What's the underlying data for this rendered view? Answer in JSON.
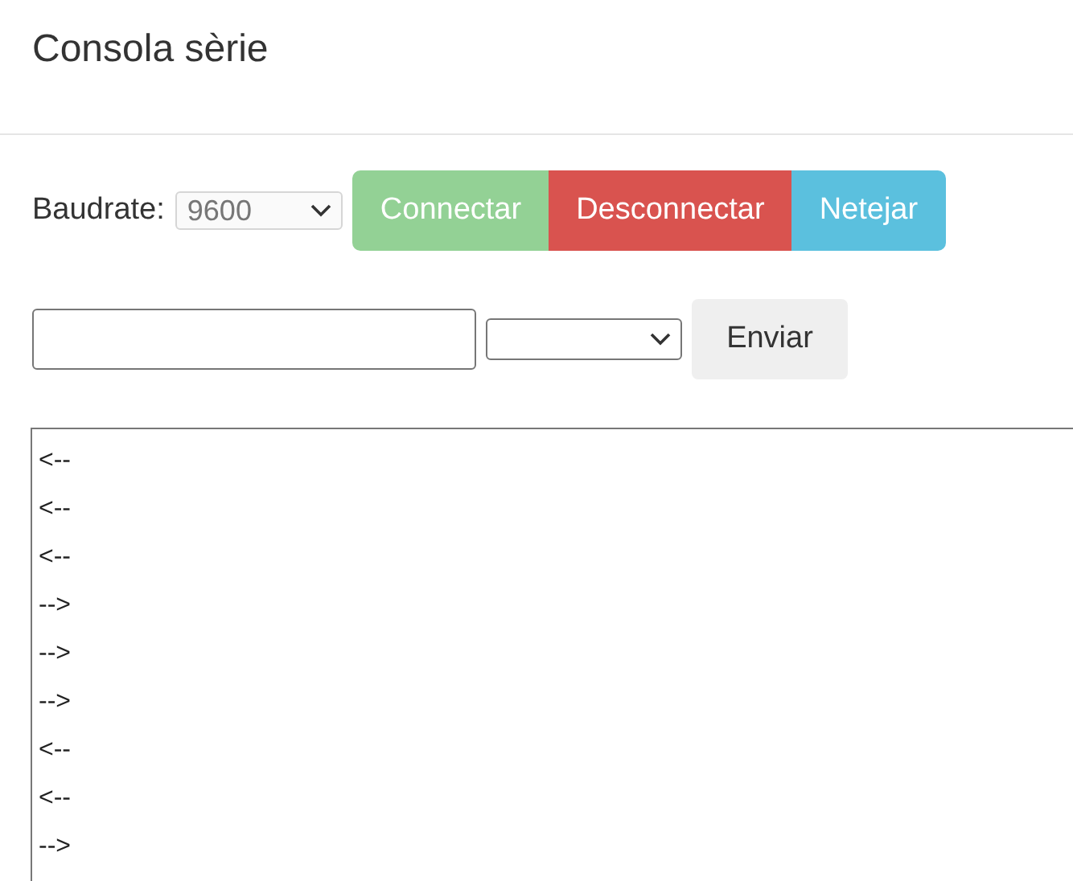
{
  "header": {
    "title": "Consola sèrie"
  },
  "controls": {
    "baud_label": "Baudrate:",
    "baud_value": "9600",
    "buttons": [
      {
        "label": "Connectar",
        "kind": "success"
      },
      {
        "label": "Desconnectar",
        "kind": "danger"
      },
      {
        "label": "Netejar",
        "kind": "info"
      }
    ]
  },
  "send": {
    "send_button": "Enviar"
  },
  "console": {
    "lines": [
      "<--",
      "<--",
      "<--",
      "-->",
      "-->",
      "-->",
      "<--",
      "<--",
      "-->"
    ]
  }
}
